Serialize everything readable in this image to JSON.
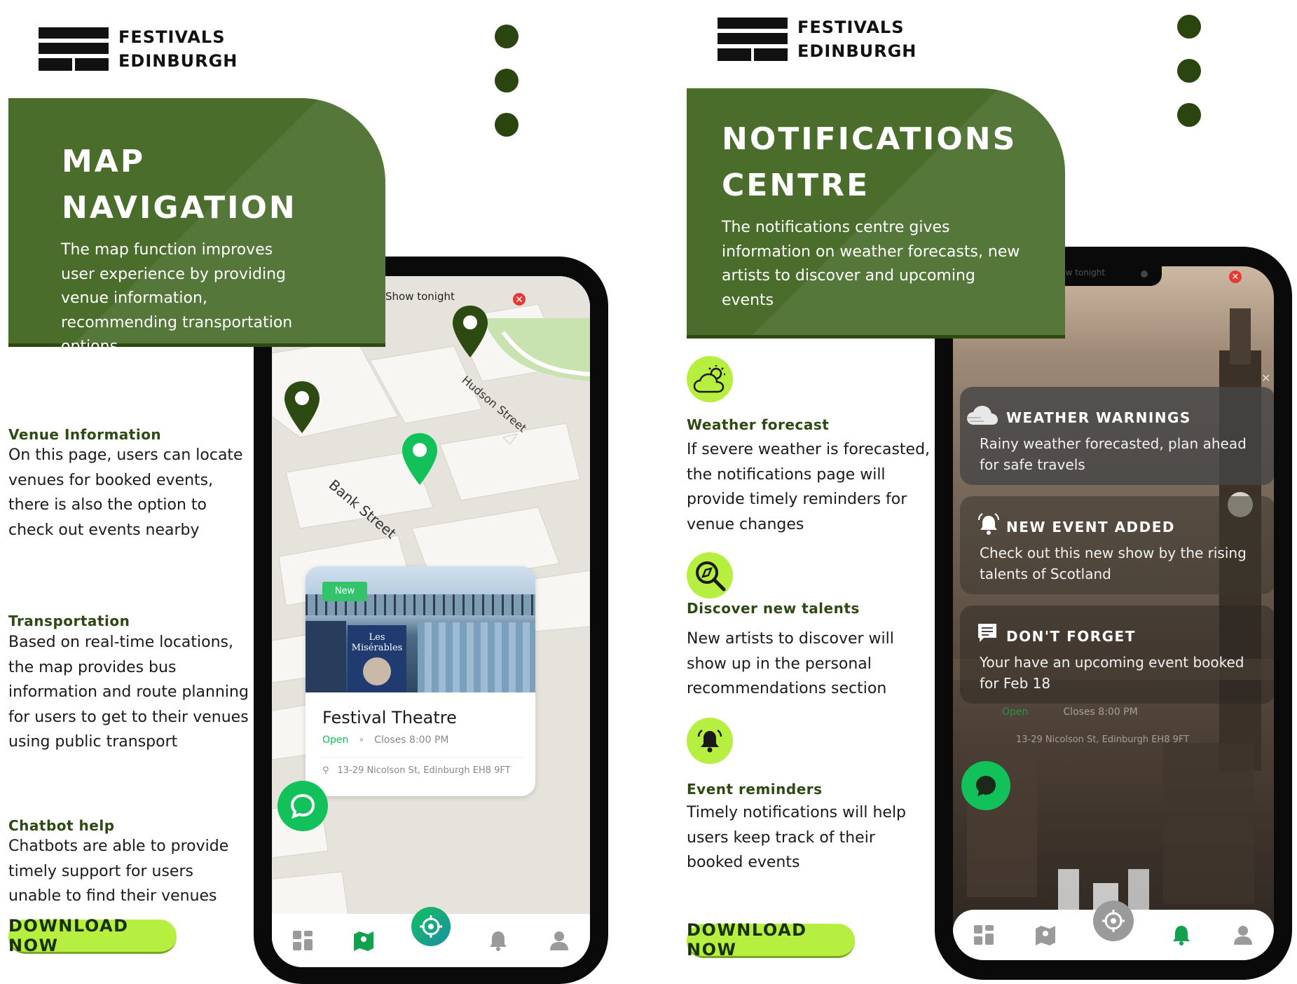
{
  "brand": {
    "line1": "FESTIVALS",
    "line2": "EDINBURGH"
  },
  "left": {
    "title_line1": "MAP",
    "title_line2": "NAVIGATION",
    "description": "The map function improves user experience by providing venue information, recommending transportation options",
    "sections": [
      {
        "title": "Venue Information",
        "body": "On this page, users can locate venues for booked events, there is also the option to check out events nearby"
      },
      {
        "title": "Transportation",
        "body": "Based on real-time locations, the map provides bus information and route planning for users to get to their venues using public transport"
      },
      {
        "title": "Chatbot help",
        "body": "Chatbots are able to provide timely support for users unable to find their venues"
      }
    ],
    "download_label": "DOWNLOAD NOW",
    "phone": {
      "search_text": "Show tonight",
      "streets": [
        "Hudson Street",
        "Bank Street"
      ],
      "venue": {
        "badge": "New",
        "poster_text": "Les Misérables",
        "name": "Festival Theatre",
        "status": "Open",
        "closes": "Closes 8:00 PM",
        "address": "13-29 Nicolson St, Edinburgh EH8 9FT"
      }
    }
  },
  "right": {
    "title_line1": "NOTIFICATIONS",
    "title_line2": "CENTRE",
    "description": "The notifications centre gives information on weather forecasts, new artists to discover and upcoming events",
    "sections": [
      {
        "title": "Weather forecast",
        "body": "If severe weather is forecasted, the notifications page will provide timely reminders for venue changes",
        "icon": "sun-cloud-icon"
      },
      {
        "title": "Discover new talents",
        "body": "New artists to discover  will show up in the personal recommendations section",
        "icon": "discover-search-icon"
      },
      {
        "title": "Event reminders",
        "body": "Timely notifications will help users keep track of their booked events",
        "icon": "bell-ringing-icon"
      }
    ],
    "download_label": "DOWNLOAD NOW",
    "phone": {
      "search_text": "Show tonight",
      "notifications": [
        {
          "title": "WEATHER WARNINGS",
          "body": "Rainy weather forecasted, plan ahead for safe travels",
          "icon": "weather-cloud-icon"
        },
        {
          "title": "NEW EVENT ADDED",
          "body": "Check out this new show by the rising talents of Scotland",
          "icon": "alarm-bell-icon"
        },
        {
          "title": "DON'T FORGET",
          "body": "Your have an upcoming event booked for Feb 18",
          "icon": "message-icon"
        }
      ],
      "faded_status": "Open",
      "faded_closes": "Closes 8:00 PM",
      "faded_address": "13-29 Nicolson St, Edinburgh EH8 9FT"
    }
  },
  "colors": {
    "dark_green": "#4b6d2c",
    "lime": "#b6ef3f",
    "bright_green": "#12c15a",
    "dot": "#2b4510"
  }
}
